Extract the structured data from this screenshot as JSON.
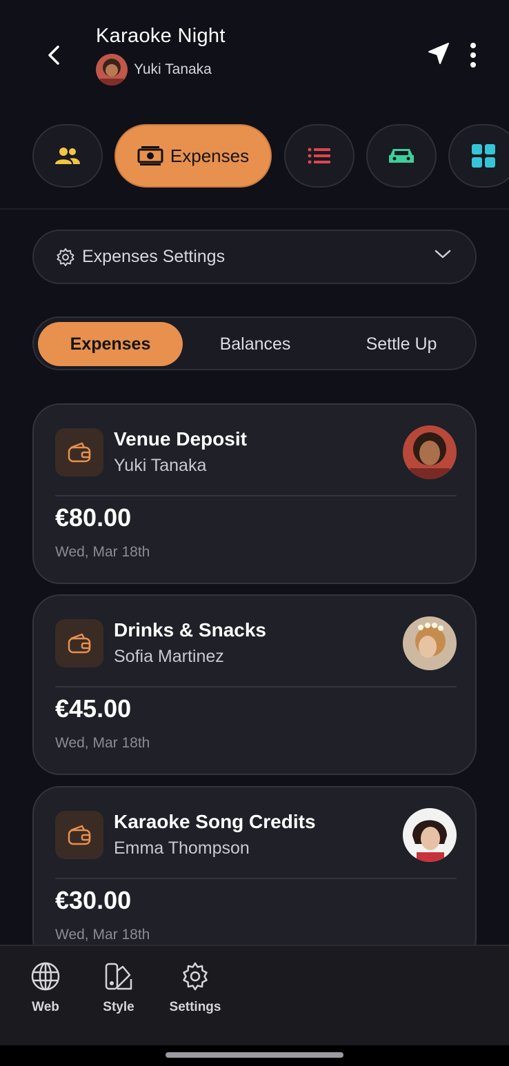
{
  "header": {
    "title": "Karaoke Night",
    "host_name": "Yuki Tanaka"
  },
  "tabs": [
    {
      "name": "members",
      "icon": "people-icon",
      "label": "",
      "color": "#f4c542"
    },
    {
      "name": "expenses",
      "icon": "money-icon",
      "label": "Expenses",
      "active": true
    },
    {
      "name": "list",
      "icon": "list-icon",
      "label": "",
      "color": "#e0454f"
    },
    {
      "name": "transport",
      "icon": "car-icon",
      "label": "",
      "color": "#3ecf9a"
    },
    {
      "name": "apps",
      "icon": "grid-icon",
      "label": "",
      "color": "#36c5d6"
    }
  ],
  "settings_bar": {
    "label": "Expenses Settings"
  },
  "segments": [
    "Expenses",
    "Balances",
    "Settle Up"
  ],
  "expenses": [
    {
      "title": "Venue Deposit",
      "payer": "Yuki Tanaka",
      "amount": "€80.00",
      "date": "Wed, Mar 18th"
    },
    {
      "title": "Drinks & Snacks",
      "payer": "Sofia Martinez",
      "amount": "€45.00",
      "date": "Wed, Mar 18th"
    },
    {
      "title": "Karaoke Song Credits",
      "payer": "Emma Thompson",
      "amount": "€30.00",
      "date": "Wed, Mar 18th"
    }
  ],
  "bottom_nav": [
    {
      "label": "Web",
      "icon": "globe-icon"
    },
    {
      "label": "Style",
      "icon": "palette-icon"
    },
    {
      "label": "Settings",
      "icon": "gear-icon"
    }
  ],
  "colors": {
    "accent": "#e8904e",
    "background": "#0f1018",
    "card": "#1f2028"
  }
}
